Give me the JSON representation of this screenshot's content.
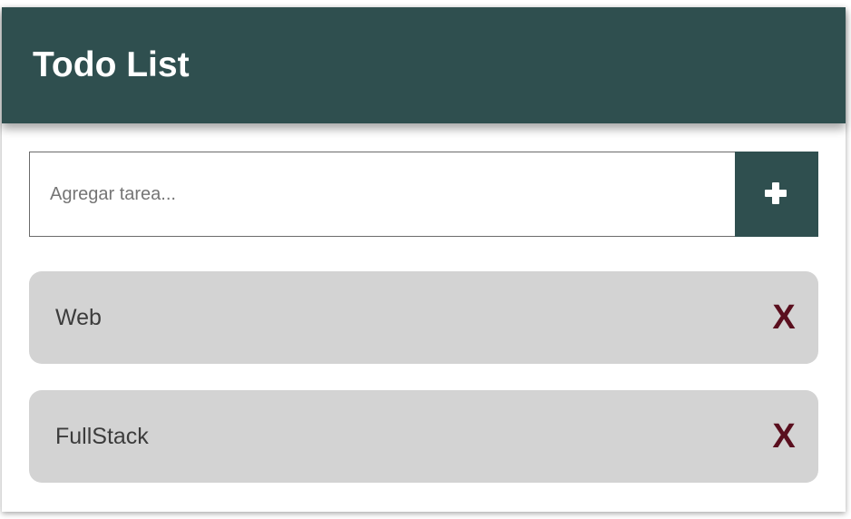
{
  "header": {
    "title": "Todo List"
  },
  "task_input": {
    "value": "",
    "placeholder": "Agregar tarea..."
  },
  "add_button": {
    "icon": "plus-icon"
  },
  "todos": [
    {
      "text": "Web",
      "delete_label": "X"
    },
    {
      "text": "FullStack",
      "delete_label": "X"
    }
  ],
  "colors": {
    "header_bg": "#2f4f4f",
    "item_bg": "#d3d3d3",
    "delete_color": "#5a0f1e"
  }
}
